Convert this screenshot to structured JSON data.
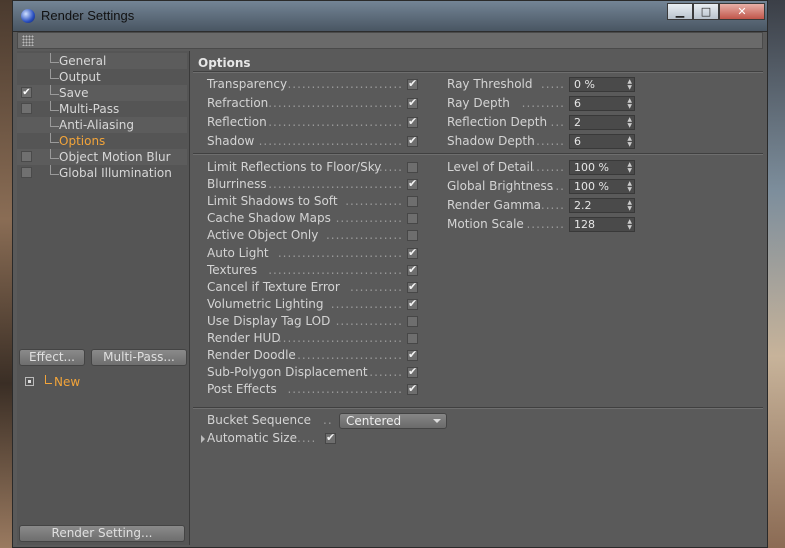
{
  "window": {
    "title": "Render Settings"
  },
  "sidebar": {
    "items": [
      {
        "label": "General",
        "checkbox": false,
        "checked": false,
        "active": false
      },
      {
        "label": "Output",
        "checkbox": false,
        "checked": false,
        "active": false
      },
      {
        "label": "Save",
        "checkbox": true,
        "checked": true,
        "active": false
      },
      {
        "label": "Multi-Pass",
        "checkbox": true,
        "checked": false,
        "active": false
      },
      {
        "label": "Anti-Aliasing",
        "checkbox": false,
        "checked": false,
        "active": false
      },
      {
        "label": "Options",
        "checkbox": false,
        "checked": false,
        "active": true
      },
      {
        "label": "Object Motion Blur",
        "checkbox": true,
        "checked": false,
        "active": false
      },
      {
        "label": "Global Illumination",
        "checkbox": true,
        "checked": false,
        "active": false
      }
    ],
    "effect_button": "Effect...",
    "multipass_button": "Multi-Pass...",
    "new_item": "New",
    "render_setting_button": "Render Setting..."
  },
  "options": {
    "title": "Options",
    "group1_left": [
      {
        "label": "Transparency",
        "dots": "........................",
        "checked": true
      },
      {
        "label": "Refraction",
        "dots": "............................",
        "checked": true
      },
      {
        "label": "Reflection",
        "dots": "............................",
        "checked": true
      },
      {
        "label": "Shadow",
        "dots": "..............................",
        "checked": true
      }
    ],
    "group1_right": [
      {
        "label": "Ray Threshold",
        "dots": ".....",
        "value": "0 %"
      },
      {
        "label": "Ray Depth",
        "dots": ".........",
        "value": "6"
      },
      {
        "label": "Reflection Depth",
        "dots": "...",
        "value": "2"
      },
      {
        "label": "Shadow Depth",
        "dots": "......",
        "value": "6"
      }
    ],
    "group2_left": [
      {
        "label": "Limit Reflections to Floor/Sky",
        "dots": "......",
        "checked": false
      },
      {
        "label": "Blurriness",
        "dots": "............................",
        "checked": true
      },
      {
        "label": "Limit Shadows to Soft",
        "dots": "............",
        "checked": false
      },
      {
        "label": "Cache Shadow Maps",
        "dots": "..............",
        "checked": false
      },
      {
        "label": "Active Object Only",
        "dots": "................",
        "checked": false
      },
      {
        "label": "Auto Light",
        "dots": "..........................",
        "checked": true
      },
      {
        "label": "Textures",
        "dots": "............................",
        "checked": true
      },
      {
        "label": "Cancel if Texture Error",
        "dots": "...........",
        "checked": true
      },
      {
        "label": "Volumetric Lighting",
        "dots": "...............",
        "checked": true
      },
      {
        "label": "Use Display Tag LOD",
        "dots": "..............",
        "checked": false
      },
      {
        "label": "Render HUD",
        "dots": "..........................",
        "checked": false
      },
      {
        "label": "Render Doodle",
        "dots": "......................",
        "checked": true
      },
      {
        "label": "Sub-Polygon Displacement",
        "dots": "........",
        "checked": true
      },
      {
        "label": "Post Effects",
        "dots": "........................",
        "checked": true
      }
    ],
    "group2_right": [
      {
        "label": "Level of Detail",
        "dots": ".......",
        "value": "100 %"
      },
      {
        "label": "Global Brightness",
        "dots": "...",
        "value": "100 %"
      },
      {
        "label": "Render Gamma",
        "dots": ".......",
        "value": "2.2"
      },
      {
        "label": "Motion Scale",
        "dots": "........",
        "value": "128"
      }
    ],
    "bucket_label": "Bucket Sequence",
    "bucket_dots": "..",
    "bucket_value": "Centered",
    "autosize_label": "Automatic Size",
    "autosize_dots": "....",
    "autosize_checked": true
  }
}
